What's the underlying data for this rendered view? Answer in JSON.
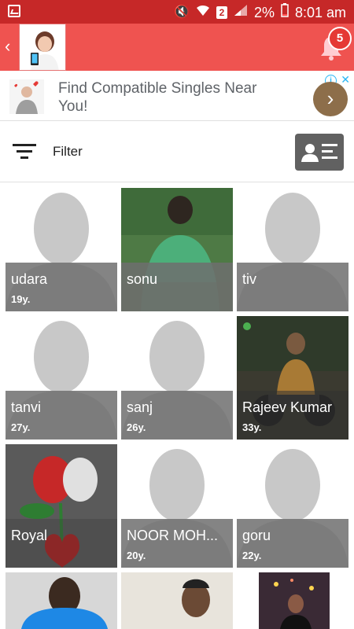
{
  "status_bar": {
    "battery_percent": "2%",
    "time": "8:01 am",
    "sim_label": "2"
  },
  "header": {
    "back_icon": "chevron-left-icon",
    "notification_count": "5"
  },
  "ad": {
    "text": "Find Compatible Singles Near You!",
    "info_icon": "info-icon",
    "close_icon": "close-icon",
    "cta_icon": "chevron-right-icon"
  },
  "filter": {
    "label": "Filter"
  },
  "profiles": [
    {
      "name": "udara",
      "age": "19y.",
      "photo": "placeholder"
    },
    {
      "name": "sonu",
      "age": "",
      "photo": "green-shirt"
    },
    {
      "name": "tiv",
      "age": "",
      "photo": "placeholder"
    },
    {
      "name": "tanvi",
      "age": "27y.",
      "photo": "placeholder"
    },
    {
      "name": "sanj",
      "age": "26y.",
      "photo": "placeholder"
    },
    {
      "name": "Rajeev Kumar",
      "age": "33y.",
      "photo": "motorbike",
      "online": true
    },
    {
      "name": "Royal",
      "age": "",
      "photo": "roses"
    },
    {
      "name": "NOOR MOH...",
      "age": "20y.",
      "photo": "placeholder"
    },
    {
      "name": "goru",
      "age": "22y.",
      "photo": "placeholder"
    },
    {
      "name": "",
      "age": "",
      "photo": "blue-shirt"
    },
    {
      "name": "",
      "age": "",
      "photo": "man-portrait"
    },
    {
      "name": "",
      "age": "",
      "photo": "woman-lights"
    }
  ],
  "colors": {
    "status_bar": "#c62828",
    "app_bar": "#ef5350",
    "badge": "#e53935",
    "overlay": "#6e6e6e",
    "online": "#4caf50"
  }
}
